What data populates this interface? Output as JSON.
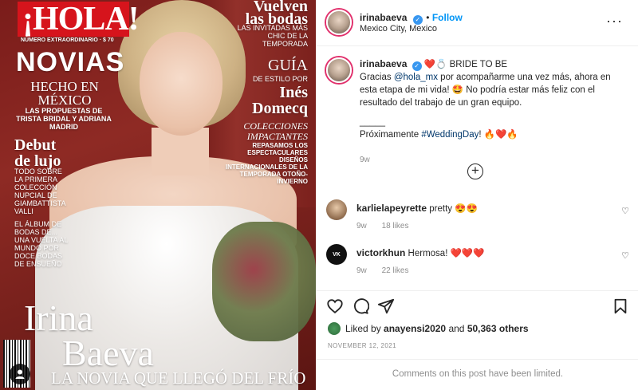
{
  "cover": {
    "logo": "¡HOLA!",
    "logo_sub": "NÚMERO EXTRAORDINARIO · $ 70",
    "novias": "NOVIAS",
    "hecho": "HECHO EN MÉXICO",
    "propuestas": "LAS PROPUESTAS DE TRISTA BRIDAL Y ADRIANA MADRID",
    "debut": "Debut de lujo",
    "todo": "TODO SOBRE LA PRIMERA COLECCIÓN NUPCIAL DE GIAMBATTISTA VALLI",
    "album": "EL ÁLBUM DE BODAS DE... UNA VUELTA AL MUNDO POR DOCE BODAS DE ENSUEÑO",
    "vuelven": "Vuelven las bodas",
    "invitadas": "LAS INVITADAS MÁS CHIC DE LA TEMPORADA",
    "guia": "GUÍA",
    "estilo": "DE ESTILO POR",
    "ines": "Inés Domecq",
    "colecciones": "COLECCIONES IMPACTANTES",
    "repasamos": "REPASAMOS LOS ESPECTACULARES DISEÑOS INTERNACIONALES DE LA TEMPORADA OTOÑO-INVIERNO",
    "name_first": "Irina",
    "name_last": "Baeva",
    "tagline": "LA NOVIA QUE LLEGÓ DEL FRÍO"
  },
  "header": {
    "username": "irinabaeva",
    "follow_label": "Follow",
    "location": "Mexico City, Mexico",
    "more": "···"
  },
  "caption": {
    "username": "irinabaeva",
    "title_suffix": "BRIDE TO BE",
    "line_pre_mention": "Gracias ",
    "mention": "@hola_mx",
    "line_post_mention": " por acompañarme una vez más, ahora en esta etapa de mi vida! 🤩 No podría estar más feliz con el resultado del trabajo de un gran equipo.",
    "divider": "_____",
    "proximamente": "Próximamente ",
    "hashtag": "#WeddingDay",
    "after_hashtag": "! 🔥❤️🔥",
    "age": "9w"
  },
  "comments": [
    {
      "username": "karlielapeyrette",
      "text": "pretty 😍😍",
      "age": "9w",
      "likes": "18 likes"
    },
    {
      "username": "victorkhun",
      "text": "Hermosa! ❤️❤️❤️",
      "age": "9w",
      "likes": "22 likes"
    }
  ],
  "likes": {
    "prefix": "Liked by ",
    "user": "anayensi2020",
    "middle": " and ",
    "count": "50,363 others"
  },
  "date": "NOVEMBER 12, 2021",
  "limited": "Comments on this post have been limited.",
  "colors": {
    "accent": "#0095f6",
    "hola_red": "#d6141c",
    "muted": "#8e8e8e"
  }
}
